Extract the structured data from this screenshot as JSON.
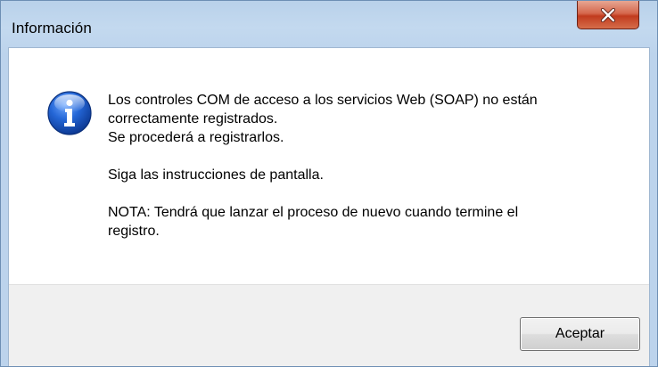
{
  "window": {
    "title": "Información"
  },
  "icons": {
    "close": "close-icon",
    "info": "information-icon"
  },
  "message": {
    "lines": [
      "Los controles COM de acceso a los servicios Web (SOAP) no están",
      "correctamente registrados.",
      "Se procederá a registrarlos.",
      "Siga las instrucciones de pantalla.",
      "NOTA: Tendrá que lanzar el proceso de nuevo cuando termine el",
      "registro."
    ]
  },
  "buttons": {
    "accept_label": "Aceptar"
  },
  "colors": {
    "titlebar": "#b9d1ea",
    "close_button": "#c9472b",
    "footer": "#f0f0f0",
    "info_icon": "#1f5fbf"
  }
}
